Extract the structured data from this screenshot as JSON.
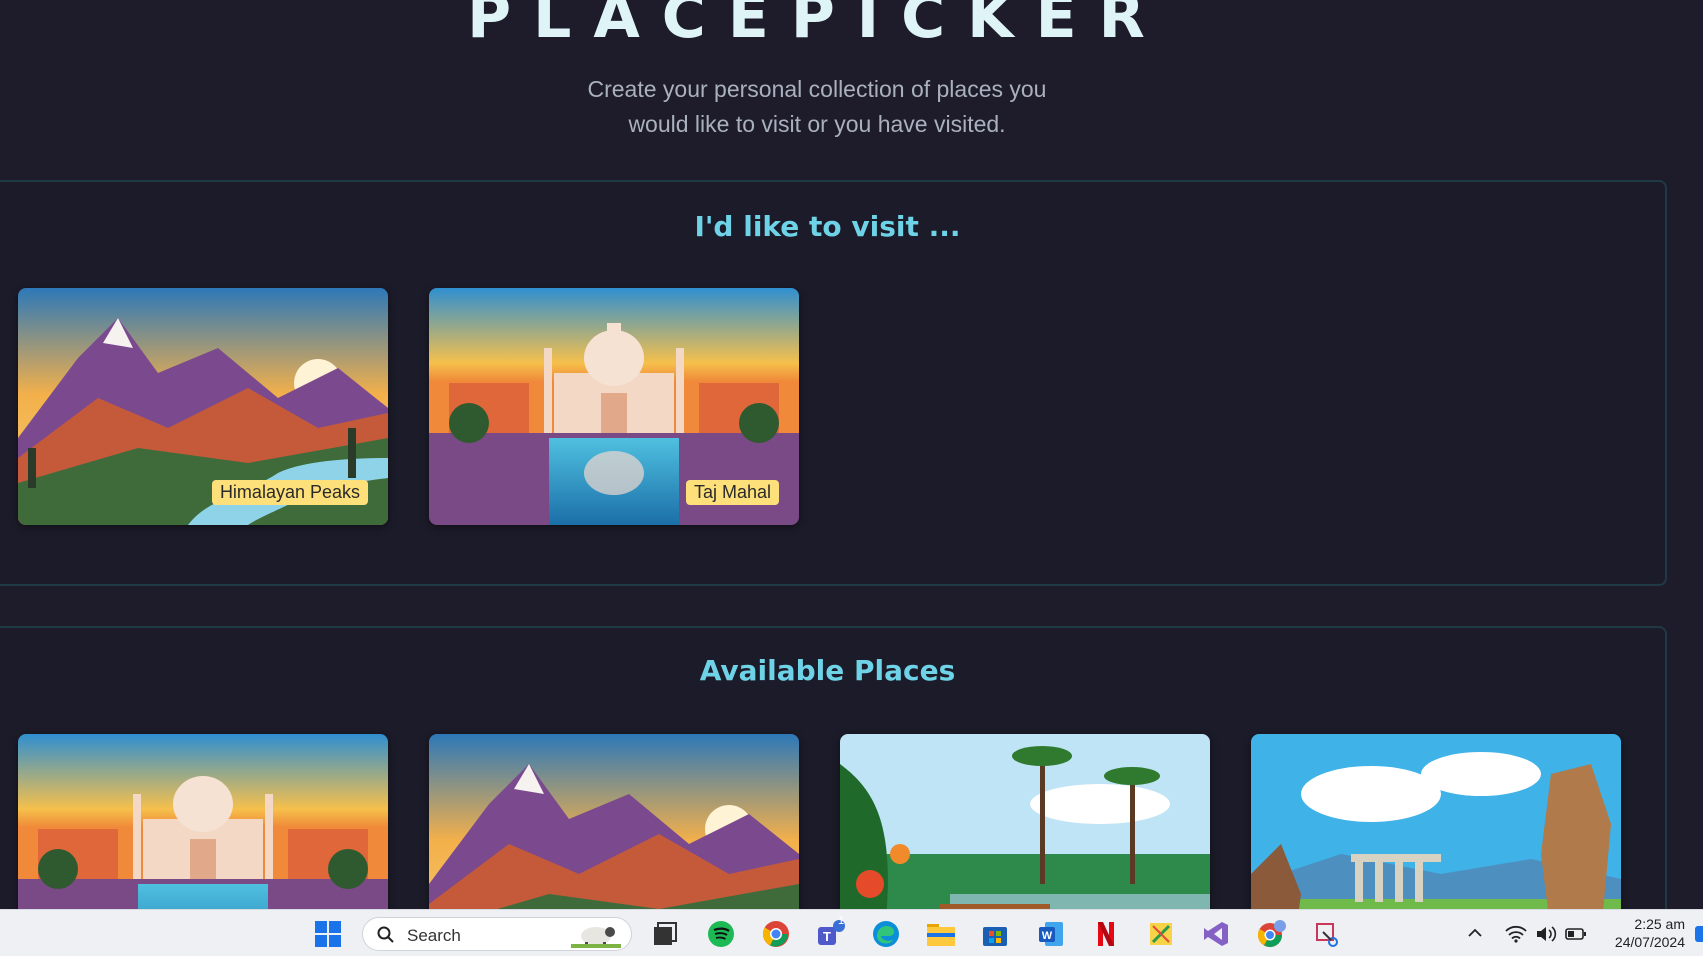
{
  "header": {
    "title": "PLACEPICKER",
    "subtitle_line1": "Create your personal collection of places you",
    "subtitle_line2": "would like to visit or you have visited."
  },
  "visit_section": {
    "title": "I'd like to visit ...",
    "places": [
      {
        "label": "Himalayan Peaks",
        "scene": "mountains"
      },
      {
        "label": "Taj Mahal",
        "scene": "taj-mahal"
      }
    ]
  },
  "available_section": {
    "title": "Available Places",
    "places": [
      {
        "scene": "taj-mahal"
      },
      {
        "scene": "mountains"
      },
      {
        "scene": "tropical-backwaters"
      },
      {
        "scene": "ancient-ruins"
      }
    ]
  },
  "taskbar": {
    "search_placeholder": "Search",
    "teams_badge": "1",
    "time": "2:25 am",
    "date": "24/07/2024",
    "icons": [
      "windows-start-icon",
      "search-icon",
      "task-view-icon",
      "spotify-icon",
      "chrome-icon",
      "teams-icon",
      "edge-icon",
      "file-explorer-icon",
      "ms-store-icon",
      "word-icon",
      "netflix-icon",
      "sticky-tool-icon",
      "visual-studio-icon",
      "chrome-profile-icon",
      "snipping-tool-icon",
      "chevron-up-icon",
      "wifi-icon",
      "volume-icon",
      "battery-icon",
      "notification-icon"
    ]
  },
  "colors": {
    "background": "#1e1c2b",
    "title": "#dff4f7",
    "section_heading": "#6fd3e8",
    "label_bg": "#fde07a",
    "section_border": "#1f3a45"
  }
}
